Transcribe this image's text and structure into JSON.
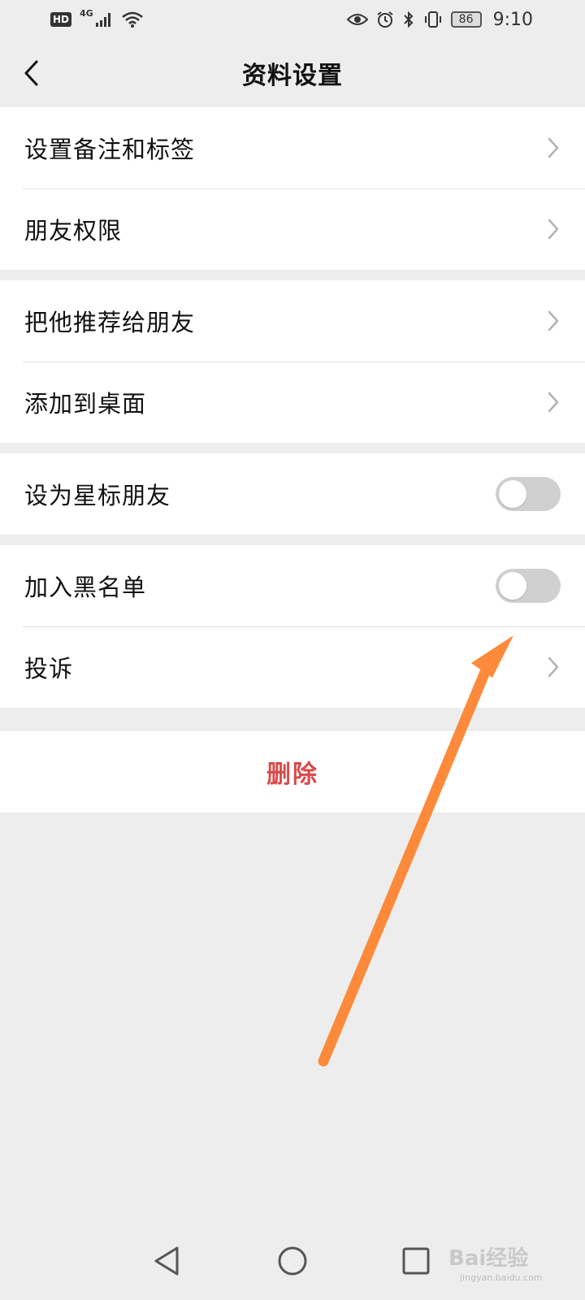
{
  "status_bar": {
    "hd": "HD",
    "network": "4G",
    "battery": "86",
    "time": "9:10",
    "icons": [
      "signal-icon",
      "wifi-icon",
      "eye-icon",
      "alarm-icon",
      "bluetooth-icon",
      "vibrate-icon",
      "battery-icon"
    ]
  },
  "header": {
    "title": "资料设置",
    "back_icon": "chevron-left-icon"
  },
  "groups": [
    {
      "items": [
        {
          "label": "设置备注和标签",
          "control": "chevron"
        },
        {
          "label": "朋友权限",
          "control": "chevron"
        }
      ]
    },
    {
      "items": [
        {
          "label": "把他推荐给朋友",
          "control": "chevron"
        },
        {
          "label": "添加到桌面",
          "control": "chevron"
        }
      ]
    },
    {
      "items": [
        {
          "label": "设为星标朋友",
          "control": "toggle",
          "value": false
        }
      ]
    },
    {
      "items": [
        {
          "label": "加入黑名单",
          "control": "toggle",
          "value": false
        },
        {
          "label": "投诉",
          "control": "chevron"
        }
      ]
    }
  ],
  "delete": {
    "label": "删除",
    "color": "#d94a4a"
  },
  "annotation": {
    "arrow_color": "#fd8a3a"
  },
  "system_nav": {
    "icons": [
      "back-triangle-icon",
      "home-circle-icon",
      "recents-square-icon"
    ]
  },
  "watermark": {
    "logo": "Bai经验",
    "url": "jingyan.baidu.com"
  },
  "colors": {
    "background": "#ededed",
    "toggle_off": "#d0d0d0",
    "chevron": "#b2b2b2"
  }
}
